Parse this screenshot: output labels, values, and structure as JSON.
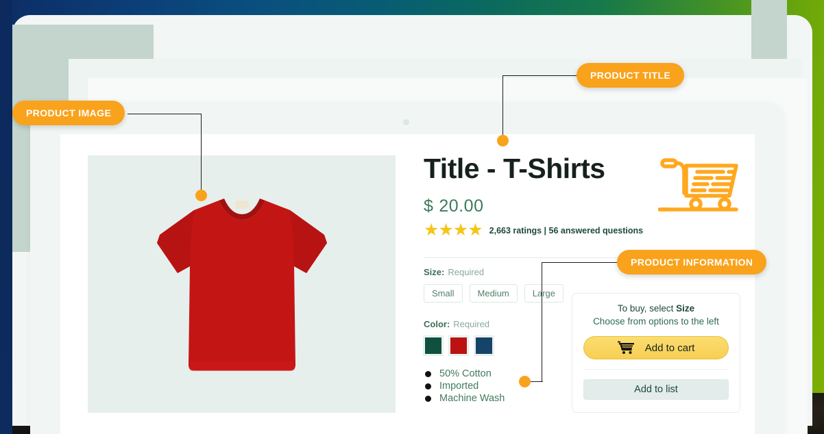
{
  "annotations": [
    {
      "id": "product-image",
      "label": "PRODUCT IMAGE"
    },
    {
      "id": "product-title",
      "label": "PRODUCT TITLE"
    },
    {
      "id": "product-information",
      "label": "PRODUCT INFORMATION"
    }
  ],
  "product": {
    "title": "Title - T-Shirts",
    "currency": "$",
    "price": "20.00",
    "stars": "★★★★",
    "stars_count": 4,
    "rating_text": "2,663 ratings | 56 answered questions",
    "ratings_count": "2,663",
    "answered_questions": "56",
    "image_alt": "red-tshirt",
    "cart_icon": "shopping-cart-icon"
  },
  "options": {
    "size": {
      "label": "Size:",
      "requirement": "Required",
      "values": [
        "Small",
        "Medium",
        "Large"
      ]
    },
    "color": {
      "label": "Color:",
      "requirement": "Required",
      "values": [
        {
          "name": "Dark Green",
          "hex": "#10503f"
        },
        {
          "name": "Red",
          "hex": "#bc1212"
        },
        {
          "name": "Navy Blue",
          "hex": "#154468"
        }
      ]
    }
  },
  "features": [
    "50% Cotton",
    "Imported",
    "Machine Wash"
  ],
  "buybox": {
    "prompt_prefix": "To buy, select ",
    "prompt_bold": "Size",
    "subprompt": "Choose from options to the left",
    "add_to_cart": "Add to cart",
    "add_to_cart_icon": "shopping-cart-icon",
    "add_to_list": "Add to list"
  },
  "colors": {
    "accent": "#f9a21b",
    "cart_button": "#f7cf52",
    "price_text": "#3f7a5d",
    "star": "#f5c518",
    "product_bg": "#e7efec"
  }
}
